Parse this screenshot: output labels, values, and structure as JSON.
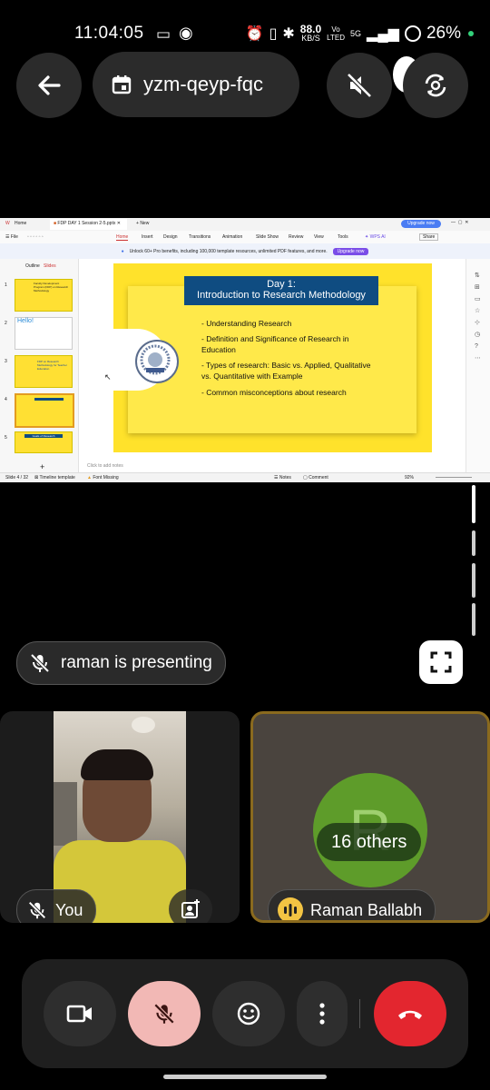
{
  "status_bar": {
    "time": "11:04:05",
    "net_speed": "88.0",
    "net_unit": "KB/S",
    "vo": "Vo",
    "lte": "LTED",
    "signal_label": "5G",
    "battery": "26%"
  },
  "meeting": {
    "code": "yzm-qeyp-fqc"
  },
  "presentation": {
    "app_home": "Home",
    "file_name": "FDP DAY 1 Session 2-5.pptx",
    "new_tab": "New",
    "upgrade_now": "Upgrade now",
    "ribbon_tabs": [
      "Home",
      "Insert",
      "Design",
      "Transitions",
      "Animation",
      "Slide Show",
      "Review",
      "View",
      "Tools"
    ],
    "file_menu": "File",
    "wps_ai": "WPS AI",
    "share": "Share",
    "banner_text": "Unlock 60+ Pro benefits, including 100,000 template resources, unlimited PDF features, and more.",
    "banner_button": "Upgrade now",
    "outline_tab": "Outline",
    "slides_tab": "Slides",
    "thumb_labels": [
      "Faculty Development Program (FDP) on Research Methodology",
      "Hello!",
      "FDP on Research Methodology for Teacher Education",
      "",
      "Goals of Research"
    ],
    "slide_title_line1": "Day 1:",
    "slide_title_line2": "Introduction to Research Methodology",
    "bullets": [
      "- Understanding Research",
      "- Definition and Significance of Research in Education",
      "- Types of research: Basic vs. Applied, Qualitative vs. Quantitative with Example",
      "- Common misconceptions about research"
    ],
    "notes_placeholder": "Click to add notes",
    "slide_counter": "Slide 4 / 32",
    "template_label": "Timeline template",
    "font_missing": "Font Missing",
    "notes_btn": "Notes",
    "comment_btn": "Comment",
    "zoom": "92%"
  },
  "presenter_chip": "raman is presenting",
  "tiles": {
    "you_label": "You",
    "others_avatar_letter": "R",
    "others_count": "16 others",
    "speaker_name": "Raman Ballabh"
  },
  "colors": {
    "hangup": "#e3262f",
    "mic_off": "#f2b8b5",
    "others_border": "#8a6a1e",
    "avatar": "#5e9c2a"
  }
}
